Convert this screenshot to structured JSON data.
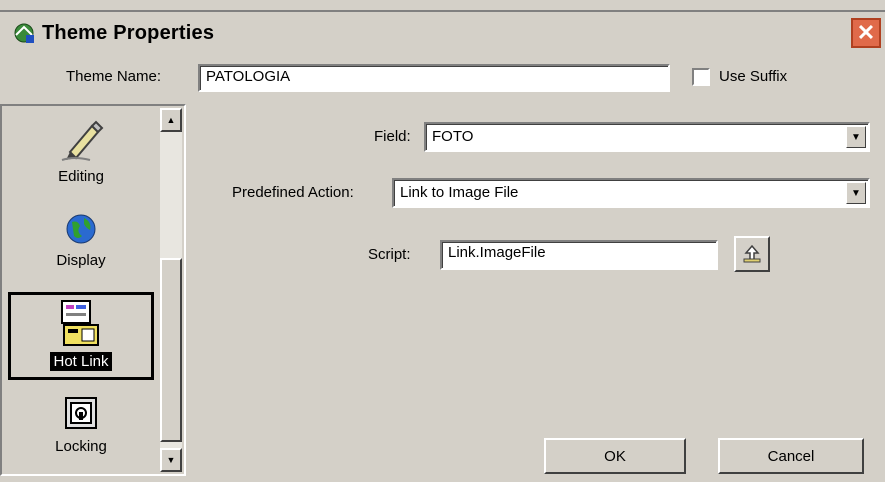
{
  "window": {
    "title": "Theme Properties",
    "close_glyph": "✕"
  },
  "top": {
    "theme_name_label": "Theme Name:",
    "theme_name_value": "PATOLOGIA",
    "use_suffix_label": "Use Suffix",
    "use_suffix_checked": false
  },
  "sidebar": {
    "items": [
      {
        "label": "Editing",
        "icon": "pencil-icon",
        "selected": false
      },
      {
        "label": "Display",
        "icon": "globe-icon",
        "selected": false
      },
      {
        "label": "Hot Link",
        "icon": "hotlink-icon",
        "selected": true
      },
      {
        "label": "Locking",
        "icon": "lock-icon",
        "selected": false
      }
    ],
    "scroll_up": "▲",
    "scroll_down": "▼"
  },
  "form": {
    "field_label": "Field:",
    "field_value": "FOTO",
    "predefined_action_label": "Predefined Action:",
    "predefined_action_value": "Link to Image File",
    "script_label": "Script:",
    "script_value": "Link.ImageFile",
    "dropdown_arrow": "▼"
  },
  "buttons": {
    "ok": "OK",
    "cancel": "Cancel"
  },
  "colors": {
    "face": "#d4d0c8",
    "close": "#e06a4a",
    "selected_label_bg": "#000000"
  }
}
